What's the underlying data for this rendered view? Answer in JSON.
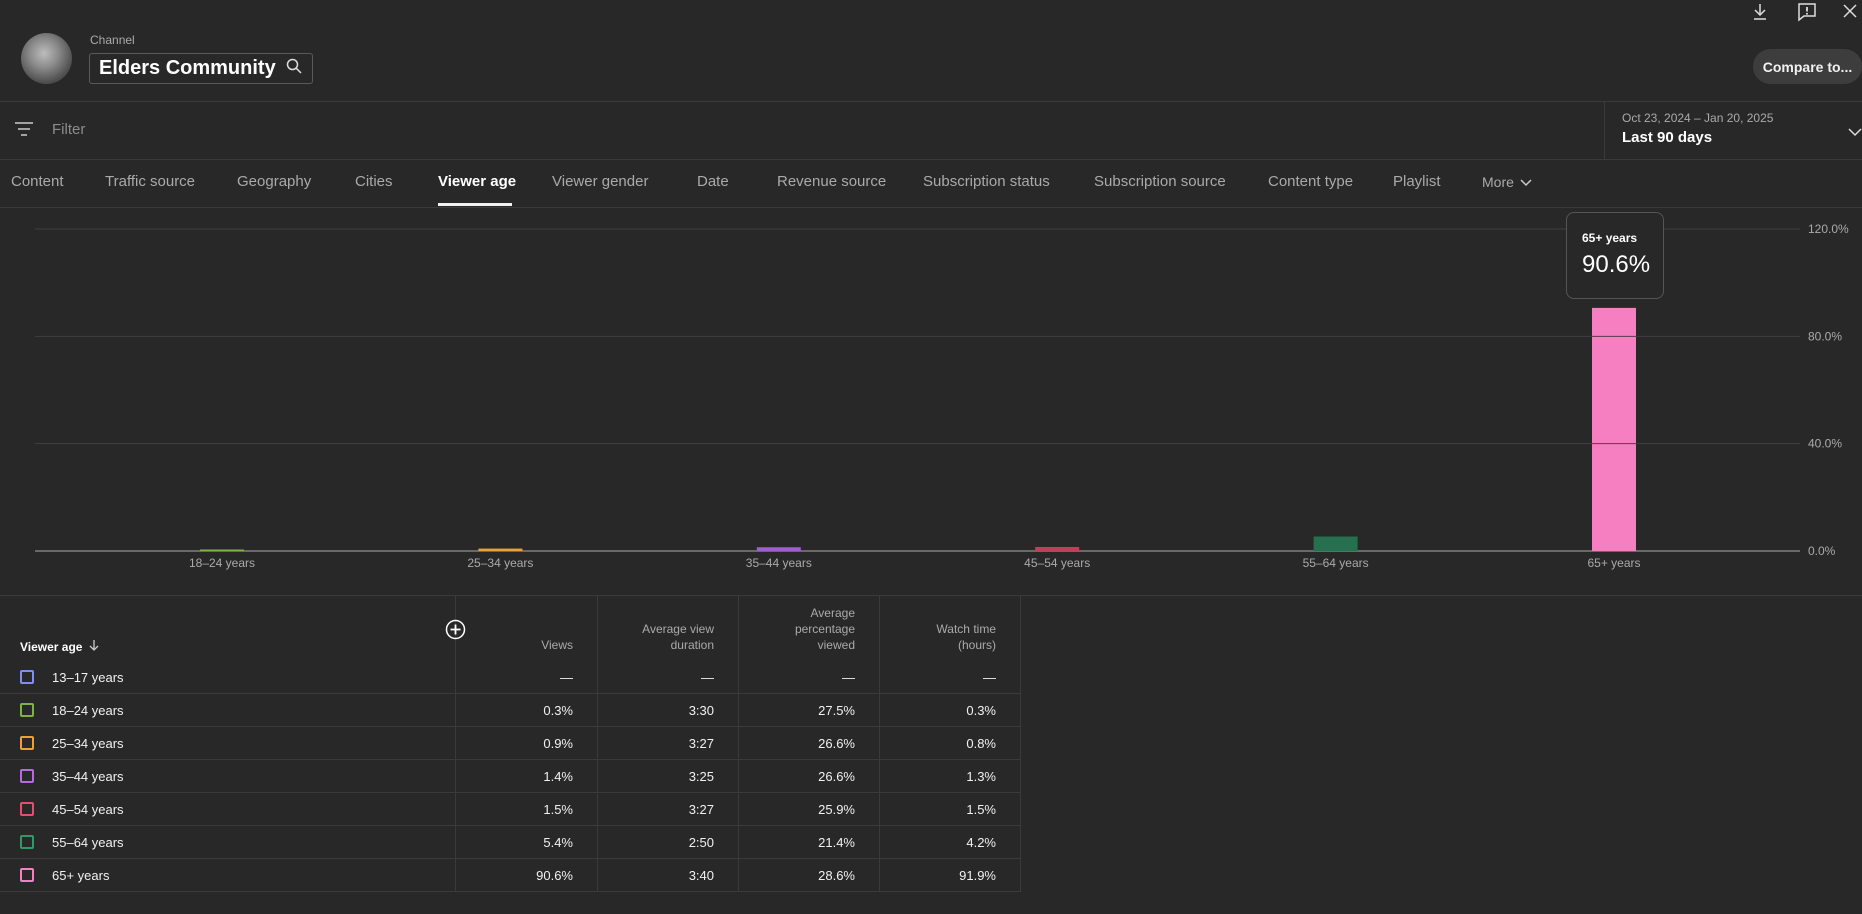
{
  "header": {
    "channel_label": "Channel",
    "channel_name": "Elders Community",
    "compare_label": "Compare to..."
  },
  "filter": {
    "placeholder": "Filter"
  },
  "date": {
    "range": "Oct 23, 2024 – Jan 20, 2025",
    "label": "Last 90 days"
  },
  "tabs": [
    {
      "label": "Content"
    },
    {
      "label": "Traffic source"
    },
    {
      "label": "Geography"
    },
    {
      "label": "Cities"
    },
    {
      "label": "Viewer age"
    },
    {
      "label": "Viewer gender"
    },
    {
      "label": "Date"
    },
    {
      "label": "Revenue source"
    },
    {
      "label": "Subscription status"
    },
    {
      "label": "Subscription source"
    },
    {
      "label": "Content type"
    },
    {
      "label": "Playlist"
    },
    {
      "label": "More"
    }
  ],
  "chart_data": {
    "type": "bar",
    "categories": [
      "18–24 years",
      "25–34 years",
      "35–44 years",
      "45–54 years",
      "55–64 years",
      "65+ years"
    ],
    "values": [
      0.3,
      0.9,
      1.4,
      1.5,
      5.4,
      90.6
    ],
    "colors": [
      "#7cb342",
      "#f0a030",
      "#a15ed0",
      "#c0405a",
      "#26704f",
      "#f57fc0"
    ],
    "ylim": [
      0,
      120
    ],
    "y_ticks": [
      "0.0%",
      "40.0%",
      "80.0%",
      "120.0%"
    ],
    "y_tick_values": [
      0,
      40,
      80,
      120
    ],
    "axis_side": "right",
    "grid": true
  },
  "tooltip": {
    "title": "65+ years",
    "value": "90.6%"
  },
  "table": {
    "columns": [
      "Viewer age",
      "Views",
      "Average view duration",
      "Average percentage viewed",
      "Watch time (hours)"
    ],
    "rows": [
      {
        "label": "13–17 years",
        "color": "#7f8ff0",
        "views": "—",
        "avd": "—",
        "apv": "—",
        "wt": "—"
      },
      {
        "label": "18–24 years",
        "color": "#7cb342",
        "views": "0.3%",
        "avd": "3:30",
        "apv": "27.5%",
        "wt": "0.3%"
      },
      {
        "label": "25–34 years",
        "color": "#f0a030",
        "views": "0.9%",
        "avd": "3:27",
        "apv": "26.6%",
        "wt": "0.8%"
      },
      {
        "label": "35–44 years",
        "color": "#b36be0",
        "views": "1.4%",
        "avd": "3:25",
        "apv": "26.6%",
        "wt": "1.3%"
      },
      {
        "label": "45–54 years",
        "color": "#e0506f",
        "views": "1.5%",
        "avd": "3:27",
        "apv": "25.9%",
        "wt": "1.5%"
      },
      {
        "label": "55–64 years",
        "color": "#2e9a6a",
        "views": "5.4%",
        "avd": "2:50",
        "apv": "21.4%",
        "wt": "4.2%"
      },
      {
        "label": "65+ years",
        "color": "#f57fc0",
        "views": "90.6%",
        "avd": "3:40",
        "apv": "28.6%",
        "wt": "91.9%"
      }
    ]
  }
}
